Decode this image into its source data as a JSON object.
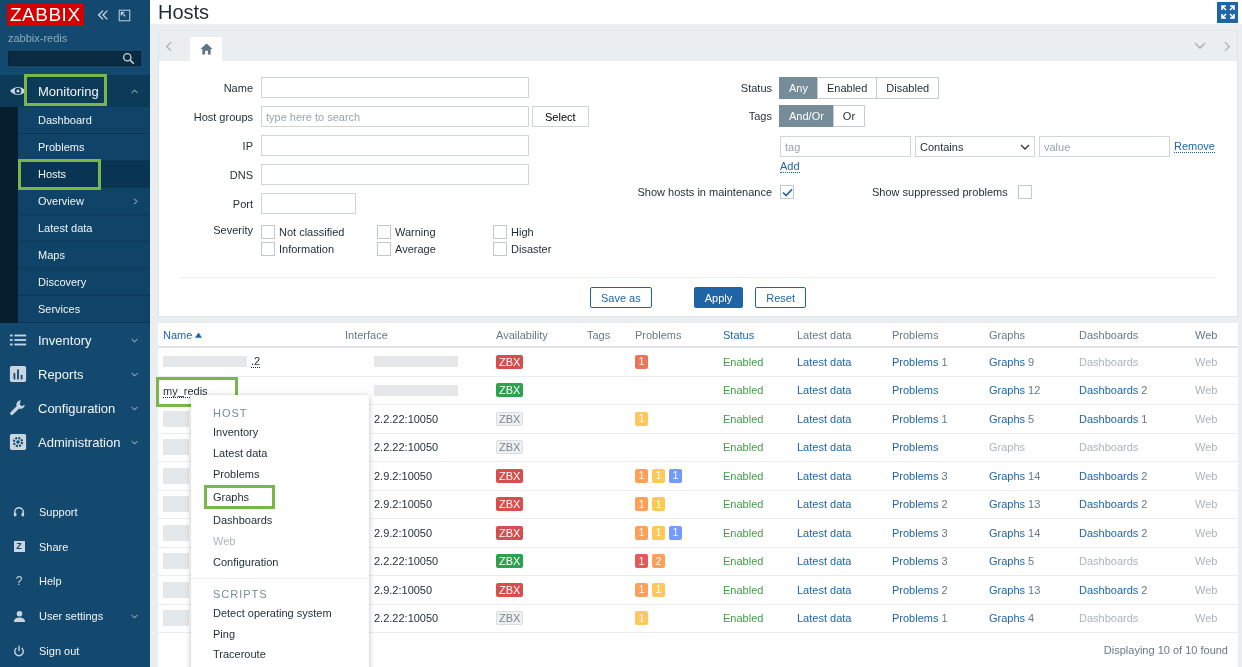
{
  "sidebar": {
    "logo": "ZABBIX",
    "server": "zabbix-redis",
    "sections": [
      {
        "label": "Monitoring",
        "expanded": true,
        "highlighted": true,
        "children": [
          {
            "label": "Dashboard",
            "selected": false,
            "highlighted": false,
            "has_submenu": false
          },
          {
            "label": "Problems",
            "selected": false,
            "highlighted": false,
            "has_submenu": false
          },
          {
            "label": "Hosts",
            "selected": true,
            "highlighted": true,
            "has_submenu": false
          },
          {
            "label": "Overview",
            "selected": false,
            "highlighted": false,
            "has_submenu": true
          },
          {
            "label": "Latest data",
            "selected": false,
            "highlighted": false,
            "has_submenu": false
          },
          {
            "label": "Maps",
            "selected": false,
            "highlighted": false,
            "has_submenu": false
          },
          {
            "label": "Discovery",
            "selected": false,
            "highlighted": false,
            "has_submenu": false
          },
          {
            "label": "Services",
            "selected": false,
            "highlighted": false,
            "has_submenu": false
          }
        ]
      },
      {
        "label": "Inventory",
        "expanded": false,
        "highlighted": false
      },
      {
        "label": "Reports",
        "expanded": false,
        "highlighted": false
      },
      {
        "label": "Configuration",
        "expanded": false,
        "highlighted": false
      },
      {
        "label": "Administration",
        "expanded": false,
        "highlighted": false
      }
    ],
    "footer_items": [
      {
        "label": "Support",
        "has_submenu": false
      },
      {
        "label": "Share",
        "glyph": "Z",
        "has_submenu": false
      },
      {
        "label": "Help",
        "glyph": "?",
        "has_submenu": false
      },
      {
        "label": "User settings",
        "has_submenu": true
      },
      {
        "label": "Sign out",
        "has_submenu": false
      }
    ]
  },
  "page": {
    "title": "Hosts"
  },
  "filter": {
    "tabs": [
      {
        "kind": "home",
        "selected": true
      }
    ],
    "fields": [
      {
        "label": "Name",
        "kind": "text"
      },
      {
        "label": "Host groups",
        "kind": "multiselect",
        "placeholder": "type here to search",
        "button": "Select"
      },
      {
        "label": "IP",
        "kind": "text"
      },
      {
        "label": "DNS",
        "kind": "text"
      },
      {
        "label": "Port",
        "kind": "short"
      }
    ],
    "severity": {
      "label": "Severity",
      "options": [
        {
          "label": "Not classified",
          "checked": false
        },
        {
          "label": "Information",
          "checked": false
        },
        {
          "label": "Warning",
          "checked": false
        },
        {
          "label": "Average",
          "checked": false
        },
        {
          "label": "High",
          "checked": false
        },
        {
          "label": "Disaster",
          "checked": false
        }
      ]
    },
    "status": {
      "label": "Status",
      "options": [
        {
          "label": "Any",
          "selected": true
        },
        {
          "label": "Enabled",
          "selected": false
        },
        {
          "label": "Disabled",
          "selected": false
        }
      ]
    },
    "tags": {
      "label": "Tags",
      "options": [
        {
          "label": "And/Or",
          "selected": true
        },
        {
          "label": "Or",
          "selected": false
        }
      ],
      "rows": [
        {
          "tag_placeholder": "tag",
          "operator": "Contains",
          "value_placeholder": "value",
          "remove": "Remove"
        }
      ],
      "add": "Add"
    },
    "maintenance": {
      "label": "Show hosts in maintenance",
      "checked": true
    },
    "suppressed": {
      "label": "Show suppressed problems",
      "checked": false
    },
    "buttons": [
      {
        "label": "Save as",
        "kind": "outline"
      },
      {
        "label": "Apply",
        "kind": "primary"
      },
      {
        "label": "Reset",
        "kind": "outline"
      }
    ]
  },
  "table": {
    "columns": [
      {
        "label": "Name",
        "link": true,
        "sorted": true
      },
      {
        "label": "Interface",
        "link": false
      },
      {
        "label": "Availability",
        "link": false
      },
      {
        "label": "Tags",
        "link": false
      },
      {
        "label": "Problems",
        "link": false
      },
      {
        "label": "Status",
        "link": true
      },
      {
        "label": "Latest data",
        "link": false
      },
      {
        "label": "Problems",
        "link": false
      },
      {
        "label": "Graphs",
        "link": false
      },
      {
        "label": "Dashboards",
        "link": false
      },
      {
        "label": "Web",
        "link": false
      }
    ],
    "rows": [
      {
        "name": ".2",
        "name_redacted": true,
        "highlighted": false,
        "interface_redacted": true,
        "availability": {
          "label": "ZBX",
          "color": "#d64e4e"
        },
        "problems": [
          {
            "count": "1",
            "color": "#e97659"
          }
        ],
        "status": "Enabled",
        "latest": "Latest data",
        "problems_link": {
          "label": "Problems",
          "count": "1",
          "disabled": false
        },
        "graphs": {
          "label": "Graphs",
          "count": "9",
          "disabled": false
        },
        "dashboards": {
          "label": "Dashboards",
          "disabled": true
        },
        "web": {
          "label": "Web",
          "disabled": true
        }
      },
      {
        "name": "my_redis",
        "name_redacted": false,
        "highlighted": true,
        "interface_redacted": true,
        "availability": {
          "label": "ZBX",
          "color": "#2f9f50"
        },
        "problems": [],
        "status": "Enabled",
        "latest": "Latest data",
        "problems_link": {
          "label": "Problems",
          "disabled": false
        },
        "graphs": {
          "label": "Graphs",
          "count": "12",
          "disabled": false
        },
        "dashboards": {
          "label": "Dashboards",
          "count": "2",
          "disabled": false
        },
        "web": {
          "label": "Web",
          "disabled": true
        }
      },
      {
        "name_redacted": true,
        "highlighted": false,
        "interface": "2.2.22:10050",
        "interface_redacted": false,
        "availability": {
          "label": "ZBX",
          "color": "#eef0f1"
        },
        "problems": [
          {
            "count": "1",
            "color": "#ffc859"
          }
        ],
        "status": "Enabled",
        "latest": "Latest data",
        "problems_link": {
          "label": "Problems",
          "count": "1",
          "disabled": false
        },
        "graphs": {
          "label": "Graphs",
          "count": "5",
          "disabled": false
        },
        "dashboards": {
          "label": "Dashboards",
          "count": "1",
          "disabled": false
        },
        "web": {
          "label": "Web",
          "disabled": true
        }
      },
      {
        "name_redacted": true,
        "highlighted": false,
        "interface": "2.2.22:10050",
        "interface_redacted": false,
        "availability": {
          "label": "ZBX",
          "color": "#eef0f1"
        },
        "problems": [],
        "status": "Enabled",
        "latest": "Latest data",
        "problems_link": {
          "label": "Problems",
          "disabled": false
        },
        "graphs": {
          "label": "Graphs",
          "disabled": true
        },
        "dashboards": {
          "label": "Dashboards",
          "disabled": true
        },
        "web": {
          "label": "Web",
          "disabled": true
        }
      },
      {
        "name_redacted": true,
        "highlighted": false,
        "interface": "2.9.2:10050",
        "interface_redacted": false,
        "availability": {
          "label": "ZBX",
          "color": "#d64e4e"
        },
        "problems": [
          {
            "count": "1",
            "color": "#ffa059"
          },
          {
            "count": "1",
            "color": "#ffc859"
          },
          {
            "count": "1",
            "color": "#7499ff"
          }
        ],
        "status": "Enabled",
        "latest": "Latest data",
        "problems_link": {
          "label": "Problems",
          "count": "3",
          "disabled": false
        },
        "graphs": {
          "label": "Graphs",
          "count": "14",
          "disabled": false
        },
        "dashboards": {
          "label": "Dashboards",
          "count": "2",
          "disabled": false
        },
        "web": {
          "label": "Web",
          "disabled": true
        }
      },
      {
        "name_redacted": true,
        "highlighted": false,
        "interface": "2.9.2:10050",
        "interface_redacted": false,
        "availability": {
          "label": "ZBX",
          "color": "#d64e4e"
        },
        "problems": [
          {
            "count": "1",
            "color": "#ffa059"
          },
          {
            "count": "1",
            "color": "#ffc859"
          }
        ],
        "status": "Enabled",
        "latest": "Latest data",
        "problems_link": {
          "label": "Problems",
          "count": "2",
          "disabled": false
        },
        "graphs": {
          "label": "Graphs",
          "count": "13",
          "disabled": false
        },
        "dashboards": {
          "label": "Dashboards",
          "count": "2",
          "disabled": false
        },
        "web": {
          "label": "Web",
          "disabled": true
        }
      },
      {
        "name_redacted": true,
        "highlighted": false,
        "interface": "2.9.2:10050",
        "interface_redacted": false,
        "availability": {
          "label": "ZBX",
          "color": "#d64e4e"
        },
        "problems": [
          {
            "count": "1",
            "color": "#ffa059"
          },
          {
            "count": "1",
            "color": "#ffc859"
          },
          {
            "count": "1",
            "color": "#7499ff"
          }
        ],
        "status": "Enabled",
        "latest": "Latest data",
        "problems_link": {
          "label": "Problems",
          "count": "3",
          "disabled": false
        },
        "graphs": {
          "label": "Graphs",
          "count": "14",
          "disabled": false
        },
        "dashboards": {
          "label": "Dashboards",
          "count": "2",
          "disabled": false
        },
        "web": {
          "label": "Web",
          "disabled": true
        }
      },
      {
        "name_redacted": true,
        "highlighted": false,
        "interface": "2.2.22:10050",
        "interface_redacted": false,
        "availability": {
          "label": "ZBX",
          "color": "#2f9f50"
        },
        "problems": [
          {
            "count": "1",
            "color": "#e45959"
          },
          {
            "count": "2",
            "color": "#ffa059"
          }
        ],
        "status": "Enabled",
        "latest": "Latest data",
        "problems_link": {
          "label": "Problems",
          "count": "3",
          "disabled": false
        },
        "graphs": {
          "label": "Graphs",
          "count": "5",
          "disabled": false
        },
        "dashboards": {
          "label": "Dashboards",
          "disabled": true
        },
        "web": {
          "label": "Web",
          "disabled": true
        }
      },
      {
        "name_redacted": true,
        "highlighted": false,
        "interface": "2.9.2:10050",
        "interface_redacted": false,
        "availability": {
          "label": "ZBX",
          "color": "#d64e4e"
        },
        "problems": [
          {
            "count": "1",
            "color": "#ffa059"
          },
          {
            "count": "1",
            "color": "#ffc859"
          }
        ],
        "status": "Enabled",
        "latest": "Latest data",
        "problems_link": {
          "label": "Problems",
          "count": "2",
          "disabled": false
        },
        "graphs": {
          "label": "Graphs",
          "count": "13",
          "disabled": false
        },
        "dashboards": {
          "label": "Dashboards",
          "count": "2",
          "disabled": false
        },
        "web": {
          "label": "Web",
          "disabled": true
        }
      },
      {
        "name_redacted": true,
        "highlighted": false,
        "interface": "2.2.22:10050",
        "interface_redacted": false,
        "availability": {
          "label": "ZBX",
          "color": "#eef0f1"
        },
        "problems": [
          {
            "count": "1",
            "color": "#ffc859"
          }
        ],
        "status": "Enabled",
        "latest": "Latest data",
        "problems_link": {
          "label": "Problems",
          "count": "1",
          "disabled": false
        },
        "graphs": {
          "label": "Graphs",
          "count": "4",
          "disabled": false
        },
        "dashboards": {
          "label": "Dashboards",
          "disabled": true
        },
        "web": {
          "label": "Web",
          "disabled": true
        }
      }
    ],
    "footer": "Displaying 10 of 10 found"
  },
  "context_menu": {
    "sections": [
      {
        "title": "HOST",
        "items": [
          {
            "label": "Inventory",
            "disabled": false,
            "highlighted": false
          },
          {
            "label": "Latest data",
            "disabled": false,
            "highlighted": false
          },
          {
            "label": "Problems",
            "disabled": false,
            "highlighted": false
          },
          {
            "label": "Graphs",
            "disabled": false,
            "highlighted": true
          },
          {
            "label": "Dashboards",
            "disabled": false,
            "highlighted": false
          },
          {
            "label": "Web",
            "disabled": true,
            "highlighted": false
          },
          {
            "label": "Configuration",
            "disabled": false,
            "highlighted": false
          }
        ]
      },
      {
        "title": "SCRIPTS",
        "items": [
          {
            "label": "Detect operating system",
            "disabled": false,
            "highlighted": false
          },
          {
            "label": "Ping",
            "disabled": false,
            "highlighted": false
          },
          {
            "label": "Traceroute",
            "disabled": false,
            "highlighted": false
          }
        ]
      }
    ]
  }
}
